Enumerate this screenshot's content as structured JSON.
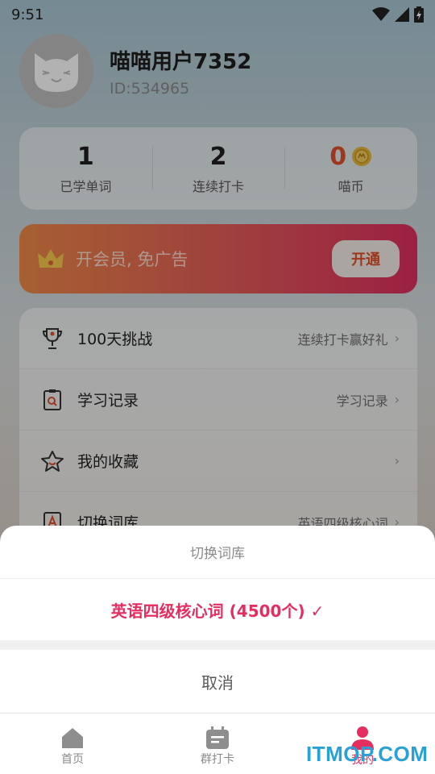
{
  "status_bar": {
    "time": "9:51"
  },
  "profile": {
    "username": "喵喵用户7352",
    "user_id": "ID:534965"
  },
  "stats": [
    {
      "value": "1",
      "label": "已学单词"
    },
    {
      "value": "2",
      "label": "连续打卡"
    },
    {
      "value": "0",
      "label": "喵币"
    }
  ],
  "vip": {
    "text": "开会员, 免广告",
    "button": "开通"
  },
  "menu": [
    {
      "title": "100天挑战",
      "subtitle": "连续打卡赢好礼",
      "icon": "trophy-icon"
    },
    {
      "title": "学习记录",
      "subtitle": "学习记录",
      "icon": "clipboard-search-icon"
    },
    {
      "title": "我的收藏",
      "subtitle": "",
      "icon": "star-icon"
    },
    {
      "title": "切换词库",
      "subtitle": "英语四级核心词",
      "icon": "book-a-icon"
    }
  ],
  "sheet": {
    "title": "切换词库",
    "option": "英语四级核心词 (4500个) ✓",
    "cancel": "取消"
  },
  "tabbar": [
    {
      "label": "首页",
      "icon": "home-icon"
    },
    {
      "label": "群打卡",
      "icon": "calendar-icon"
    },
    {
      "label": "我的",
      "icon": "person-icon"
    }
  ],
  "watermark": "ITMOP.COM",
  "colors": {
    "accent": "#e52d5f",
    "coin": "#e2502a",
    "vip_start": "#ef8a48",
    "vip_end": "#df2f5e"
  }
}
